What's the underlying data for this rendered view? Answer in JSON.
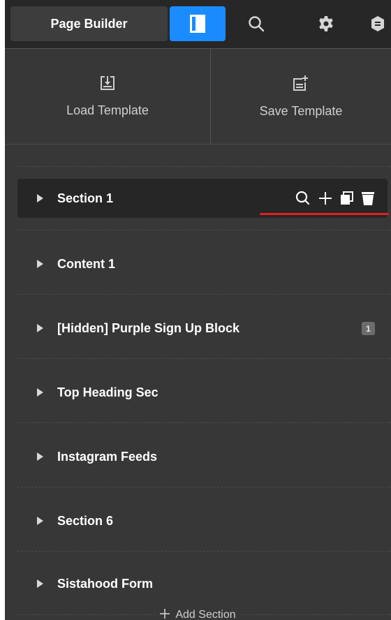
{
  "topbar": {
    "page_builder_label": "Page Builder",
    "tools": [
      {
        "icon": "layout-panel-icon",
        "active": true
      },
      {
        "icon": "search-icon",
        "active": false
      },
      {
        "icon": "gear-icon",
        "active": false
      },
      {
        "icon": "settings-extra-icon",
        "active": false
      }
    ],
    "active_color": "#1a8cff"
  },
  "templates": {
    "load_label": "Load Template",
    "save_label": "Save Template"
  },
  "sections": [
    {
      "label": "Section 1",
      "selected": true
    },
    {
      "label": "Content 1"
    },
    {
      "label": "[Hidden] Purple Sign Up Block",
      "badge": "1"
    },
    {
      "label": "Top Heading Sec"
    },
    {
      "label": "Instagram Feeds"
    },
    {
      "label": "Section 6"
    },
    {
      "label": "Sistahood Form"
    }
  ],
  "add_section_label": "Add Section",
  "highlight_color": "#e02020"
}
